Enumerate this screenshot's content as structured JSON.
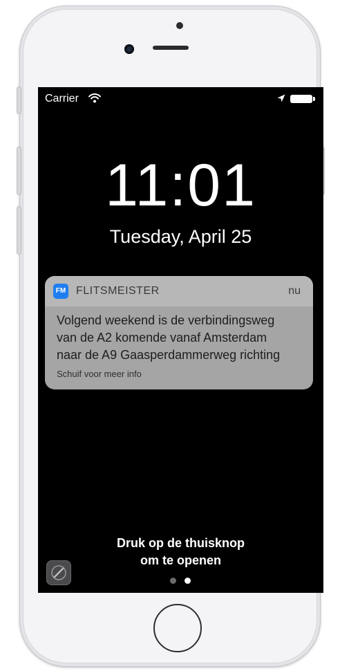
{
  "status_bar": {
    "carrier": "Carrier",
    "wifi_icon": "wifi-icon",
    "location_icon": "location-arrow-icon",
    "battery_icon": "battery-icon",
    "battery_level": 1.0
  },
  "lockscreen": {
    "time": "11:01",
    "date": "Tuesday, April 25",
    "unlock_line1": "Druk op de thuisknop",
    "unlock_line2": "om te openen"
  },
  "notification": {
    "app_icon_text": "FM",
    "app_name": "FLITSMEISTER",
    "time": "nu",
    "body_line1": "Volgend weekend is de verbindingsweg",
    "body_line2": "van de A2 komende vanaf Amsterdam",
    "body_line3": "naar de A9 Gaasperdammerweg richting",
    "hint": "Schuif voor meer info"
  },
  "pager": {
    "page_count": 2,
    "active_page": 2
  },
  "colors": {
    "app_icon_bg": "#1e7ef0",
    "screen_bg": "#000000",
    "notification_bg": "#a5a5a5"
  }
}
